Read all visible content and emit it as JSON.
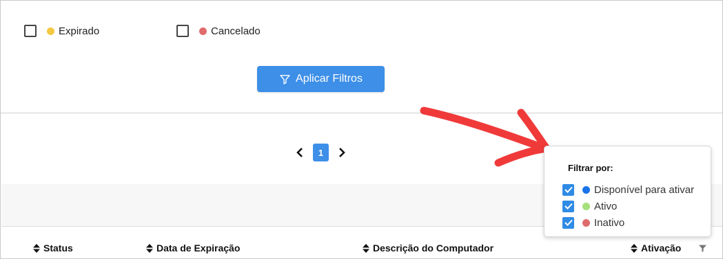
{
  "status_filters": [
    {
      "label": "Expirado",
      "color": "#f5c842",
      "checked": false
    },
    {
      "label": "Cancelado",
      "color": "#e06b6b",
      "checked": false
    }
  ],
  "apply_button": {
    "label": "Aplicar Filtros",
    "icon": "filter-icon"
  },
  "pagination": {
    "current_page": "1",
    "prev_icon": "chevron-left-icon",
    "next_icon": "chevron-right-icon"
  },
  "table": {
    "columns": [
      {
        "label": "Status",
        "sort_icon": "sort-icon"
      },
      {
        "label": "Data de Expiração",
        "sort_icon": "sort-icon"
      },
      {
        "label": "Descrição do Computador",
        "sort_icon": "sort-icon"
      },
      {
        "label": "Ativação",
        "sort_icon": "sort-icon",
        "filter_icon": "filter-icon"
      }
    ]
  },
  "filter_popover": {
    "title": "Filtrar por:",
    "options": [
      {
        "label": "Disponível para ativar",
        "color": "#1a73e8",
        "checked": true
      },
      {
        "label": "Ativo",
        "color": "#a6e07a",
        "checked": true
      },
      {
        "label": "Inativo",
        "color": "#e06b6b",
        "checked": true
      }
    ]
  },
  "colors": {
    "accent": "#3d8fe8",
    "annotation_arrow": "#f03a3a"
  }
}
